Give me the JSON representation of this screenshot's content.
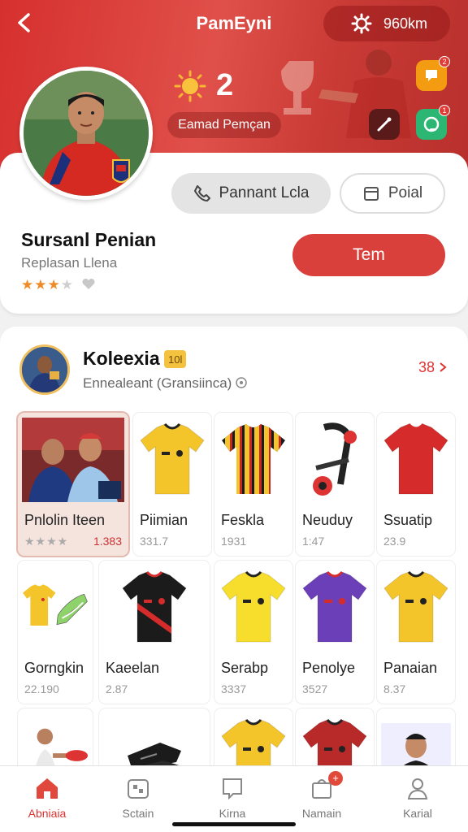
{
  "header": {
    "title": "PamEyni",
    "top_pill_value": "960km",
    "score": "2",
    "player_pill": "Eamad Pemçan",
    "noti_a_count": "2",
    "noti_b_count": "1"
  },
  "profile": {
    "call_button": "Pannant Lcla",
    "outline_button": "Poial",
    "name": "Sursanl Penian",
    "subtitle": "Replasan Llena",
    "rating": 3,
    "rating_max": 4,
    "primary_button": "Tem"
  },
  "collection": {
    "title": "Koleexia",
    "badge": "10l",
    "subtitle": "Ennealeant (Gransiinca)",
    "count": "38",
    "items": [
      {
        "name": "Pnlolin Iteen",
        "value": "1.383",
        "featured": true,
        "kind": "photo"
      },
      {
        "name": "Piimian",
        "value": "331.7",
        "kind": "jersey",
        "color": "#f4c52b",
        "trim": "#222"
      },
      {
        "name": "Feskla",
        "value": "1931",
        "kind": "stripes",
        "color": "#f4c52b",
        "trim": "#c62828"
      },
      {
        "name": "Neuduy",
        "value": "1:47",
        "kind": "gear"
      },
      {
        "name": "Ssuatip",
        "value": "23.9",
        "kind": "jersey",
        "color": "#d62b2b",
        "trim": "#d62b2b"
      },
      {
        "name": "Gorngkin",
        "value": "22.190",
        "kind": "jersey-boot",
        "color": "#f4c52b",
        "trim": "#d62b2b"
      },
      {
        "name": "Kaeelan",
        "value": "2.87",
        "kind": "sash",
        "color": "#1b1b1b",
        "trim": "#d62b2b"
      },
      {
        "name": "Serabp",
        "value": "3337",
        "kind": "jersey",
        "color": "#f7dd2c",
        "trim": "#222"
      },
      {
        "name": "Penolye",
        "value": "3527",
        "kind": "jersey",
        "color": "#6b3fb8",
        "trim": "#d62b2b"
      },
      {
        "name": "Panaian",
        "value": "8.37",
        "kind": "jersey",
        "color": "#f4c52b",
        "trim": "#222"
      },
      {
        "name": "",
        "value": "",
        "kind": "player"
      },
      {
        "name": "",
        "value": "",
        "kind": "boots"
      },
      {
        "name": "",
        "value": "",
        "kind": "jersey",
        "color": "#f4c52b",
        "trim": "#222"
      },
      {
        "name": "",
        "value": "",
        "kind": "jersey",
        "color": "#b82a2a",
        "trim": "#222"
      },
      {
        "name": "",
        "value": "",
        "kind": "portrait"
      }
    ]
  },
  "tabbar": {
    "tabs": [
      {
        "label": "Abniaia",
        "icon": "home-icon",
        "active": true
      },
      {
        "label": "Sctain",
        "icon": "scan-icon"
      },
      {
        "label": "Kirna",
        "icon": "message-icon"
      },
      {
        "label": "Namain",
        "icon": "bag-icon",
        "badge": "+"
      },
      {
        "label": "Karial",
        "icon": "profile-icon"
      }
    ]
  },
  "colors": {
    "brand": "#d9403b",
    "header": "#d6302e",
    "star": "#f08a24"
  }
}
